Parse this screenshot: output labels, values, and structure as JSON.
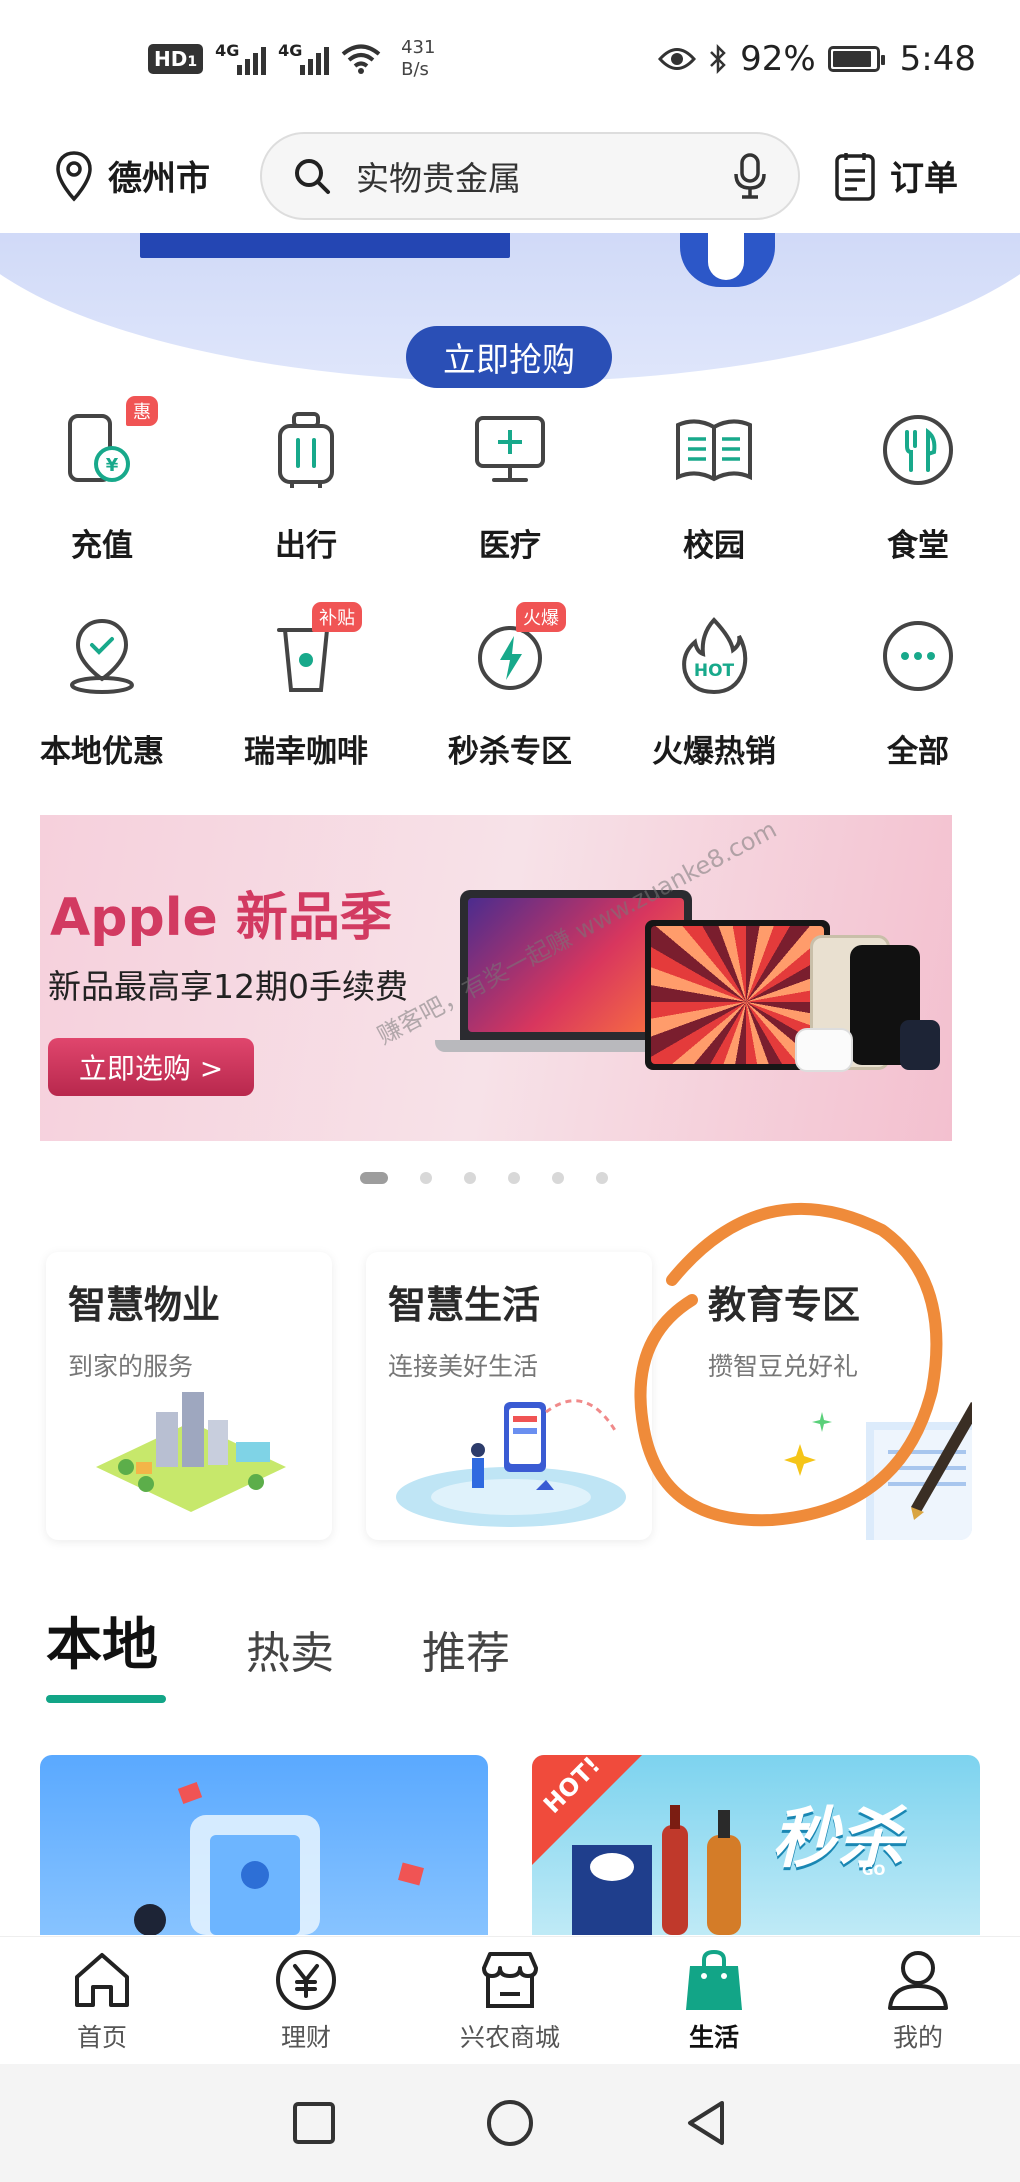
{
  "status_bar": {
    "hd_label": "HD",
    "hd_sub": "1",
    "signal1_type": "4G",
    "signal2_type": "4G",
    "net_speed_value": "431",
    "net_speed_unit": "B/s",
    "battery_text": "92%",
    "battery_level": 0.92,
    "time": "5:48"
  },
  "top_nav": {
    "city": "德州市",
    "search_placeholder": "实物贵金属",
    "orders_label": "订单"
  },
  "hero": {
    "buy_button": "立即抢购"
  },
  "services": {
    "row1": [
      {
        "label": "充值",
        "icon": "phone-recharge-icon",
        "badge": "惠"
      },
      {
        "label": "出行",
        "icon": "luggage-icon",
        "badge": ""
      },
      {
        "label": "医疗",
        "icon": "medical-monitor-icon",
        "badge": ""
      },
      {
        "label": "校园",
        "icon": "book-icon",
        "badge": ""
      },
      {
        "label": "食堂",
        "icon": "cutlery-icon",
        "badge": ""
      }
    ],
    "row2": [
      {
        "label": "本地优惠",
        "icon": "location-check-icon",
        "badge": ""
      },
      {
        "label": "瑞幸咖啡",
        "icon": "coffee-cup-icon",
        "badge": "补贴"
      },
      {
        "label": "秒杀专区",
        "icon": "flash-timer-icon",
        "badge": "火爆"
      },
      {
        "label": "火爆热销",
        "icon": "hot-flame-icon",
        "badge": ""
      },
      {
        "label": "全部",
        "icon": "more-dots-icon",
        "badge": ""
      }
    ]
  },
  "apple_banner": {
    "title": "Apple 新品季",
    "subtitle": "新品最高享12期0手续费",
    "button": "立即选购 >"
  },
  "watermark": "赚客吧，有奖一起赚 www.zuanke8.com",
  "carousel": {
    "count": 6,
    "active_index": 0
  },
  "features": [
    {
      "title": "智慧物业",
      "subtitle": "到家的服务"
    },
    {
      "title": "智慧生活",
      "subtitle": "连接美好生活"
    },
    {
      "title": "教育专区",
      "subtitle": "攒智豆兑好礼"
    }
  ],
  "tabs": [
    "本地",
    "热卖",
    "推荐"
  ],
  "products": {
    "hot_badge": "HOT!",
    "seckill_text": "秒杀",
    "seckill_sub": "GO"
  },
  "bottom_nav": [
    {
      "label": "首页",
      "icon": "home-icon"
    },
    {
      "label": "理财",
      "icon": "yuan-icon"
    },
    {
      "label": "兴农商城",
      "icon": "store-icon"
    },
    {
      "label": "生活",
      "icon": "shopping-bag-icon"
    },
    {
      "label": "我的",
      "icon": "user-icon"
    }
  ],
  "colors": {
    "accent_green": "#12a587",
    "banner_blue": "#2a4fb6",
    "apple_pink": "#d23a61",
    "badge_red": "#f05454",
    "annotation_orange": "#ef8b3a"
  }
}
